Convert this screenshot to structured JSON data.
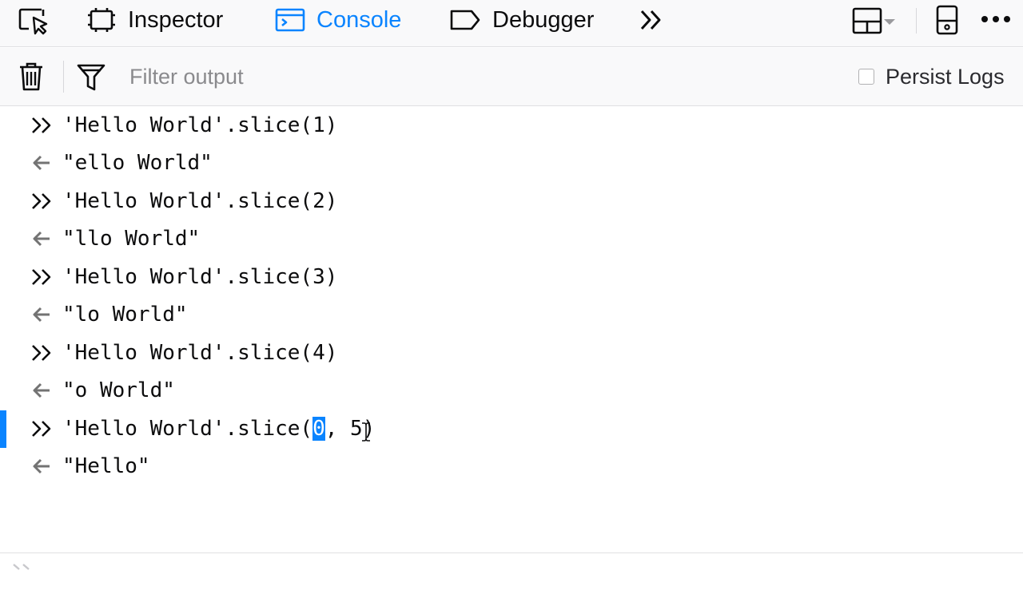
{
  "toolbar": {
    "tabs": [
      {
        "id": "inspector",
        "label": "Inspector",
        "selected": false
      },
      {
        "id": "console",
        "label": "Console",
        "selected": true
      },
      {
        "id": "debugger",
        "label": "Debugger",
        "selected": false
      }
    ],
    "icons": {
      "picker": "element-picker-icon",
      "overflow": "chevrons-right-icon",
      "layout": "dock-layout-icon",
      "responsive": "responsive-mode-icon",
      "menu": "more-options-icon"
    }
  },
  "filterbar": {
    "placeholder": "Filter output",
    "value": "",
    "persist_logs_label": "Persist Logs",
    "persist_logs_checked": false
  },
  "console": {
    "entries": [
      {
        "kind": "input",
        "text": "'Hello World'.slice(1)"
      },
      {
        "kind": "result",
        "text": "\"ello World\""
      },
      {
        "kind": "input",
        "text": "'Hello World'.slice(2)"
      },
      {
        "kind": "result",
        "text": "\"llo World\""
      },
      {
        "kind": "input",
        "text": "'Hello World'.slice(3)"
      },
      {
        "kind": "result",
        "text": "\"lo World\""
      },
      {
        "kind": "input",
        "text": "'Hello World'.slice(4)"
      },
      {
        "kind": "result",
        "text": "\"o World\""
      },
      {
        "kind": "input",
        "text": "'Hello World'.slice(0, 5)",
        "active": true,
        "pre": "'Hello World'.slice(",
        "selected": "0",
        "post": ", 5)"
      },
      {
        "kind": "result",
        "text": "\"Hello\""
      }
    ]
  },
  "colors": {
    "accent": "#0a84ff",
    "toolbar_bg": "#f9f9fa",
    "border": "#e0e0e2",
    "glyph": "#737373"
  }
}
